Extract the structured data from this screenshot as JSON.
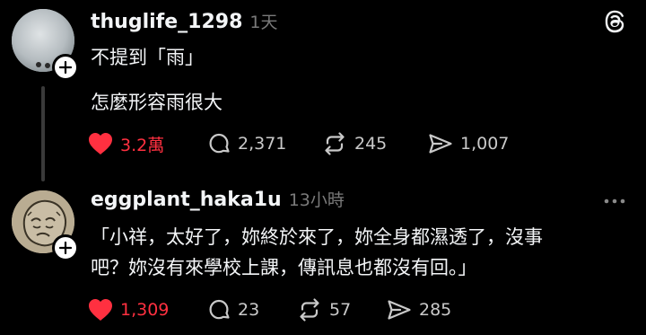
{
  "posts": [
    {
      "username": "thuglife_1298",
      "time": "1天",
      "lines": [
        "不提到「雨」",
        "怎麼形容雨很大"
      ],
      "likes": "3.2萬",
      "comments": "2,371",
      "reposts": "245",
      "shares": "1,007",
      "liked": true
    },
    {
      "username": "eggplant_haka1u",
      "time": "13小時",
      "lines": [
        "「小祥，太好了，妳終於來了，妳全身都濕透了，沒事",
        "吧？妳沒有來學校上課，傳訊息也都沒有回。」"
      ],
      "likes": "1,309",
      "comments": "23",
      "reposts": "57",
      "shares": "285",
      "liked": true
    }
  ],
  "colors": {
    "like": "#ff3040",
    "background": "#000000",
    "muted": "#7a7a7a"
  },
  "icons": [
    "threads-logo-icon",
    "heart-icon",
    "comment-icon",
    "repost-icon",
    "share-icon",
    "more-icon",
    "plus-icon"
  ]
}
